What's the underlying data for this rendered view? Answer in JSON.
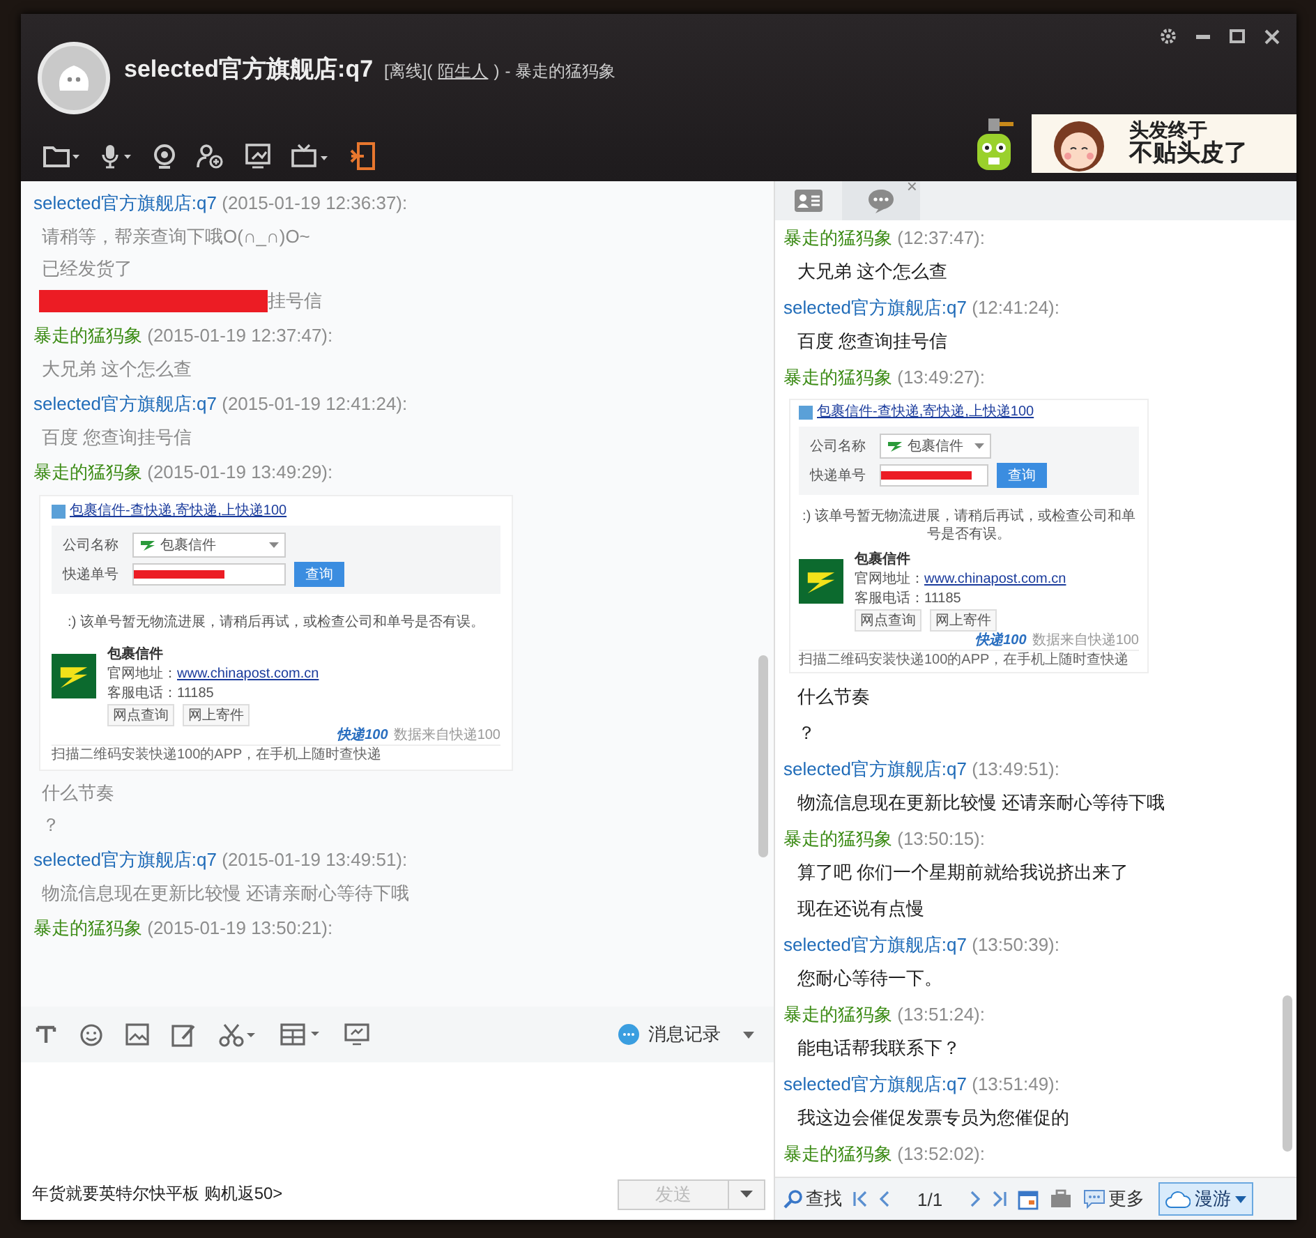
{
  "header": {
    "title": "selected官方旗舰店:q7",
    "status": "[离线](",
    "relation": "陌生人",
    "relation_suffix": ")",
    "nick": "- 暴走的猛犸象",
    "ad_lines": [
      "头发终于",
      "不贴头皮了"
    ]
  },
  "chat": {
    "messages": [
      {
        "sender": "selected官方旗舰店:q7",
        "kind": "shop",
        "time": "(2015-01-19 12:36:37):",
        "body": [
          {
            "kind": "text",
            "text": "请稍等，帮亲查询下哦O(∩_∩)O~"
          },
          {
            "kind": "text",
            "text": "已经发货了"
          },
          {
            "kind": "redacted",
            "text": "挂号信"
          }
        ]
      },
      {
        "sender": "暴走的猛犸象",
        "kind": "user",
        "time": "(2015-01-19 12:37:47):",
        "body": [
          {
            "kind": "text",
            "text": "大兄弟 这个怎么查"
          }
        ]
      },
      {
        "sender": "selected官方旗舰店:q7",
        "kind": "shop",
        "time": "(2015-01-19 12:41:24):",
        "body": [
          {
            "kind": "text",
            "text": "百度 您查询挂号信"
          }
        ]
      },
      {
        "sender": "暴走的猛犸象",
        "kind": "user",
        "time": "(2015-01-19 13:49:29):",
        "body": [
          {
            "kind": "card",
            "card": {
              "link": "包裹信件-查快递,寄快递,上快递100",
              "company_label": "公司名称",
              "company_value": "包裹信件",
              "number_label": "快递单号",
              "query_button": "查询",
              "notice": ":) 该单号暂无物流进展，请稍后再试，或检查公司和单号是否有误。",
              "carrier_name": "包裹信件",
              "site_label": "官网地址：",
              "site_url": "www.chinapost.com.cn",
              "phone": "客服电话：11185",
              "buttons": [
                "网点查询",
                "网上寄件"
              ],
              "brand": "快递100",
              "source": "数据来自快递100",
              "footer": "扫描二维码安装快递100的APP，在手机上随时查快递"
            }
          },
          {
            "kind": "text",
            "text": "什么节奏"
          },
          {
            "kind": "text",
            "text": "？"
          }
        ]
      },
      {
        "sender": "selected官方旗舰店:q7",
        "kind": "shop",
        "time": "(2015-01-19 13:49:51):",
        "body": [
          {
            "kind": "text",
            "text": "物流信息现在更新比较慢 还请亲耐心等待下哦"
          }
        ]
      },
      {
        "sender": "暴走的猛犸象",
        "kind": "user",
        "time": "(2015-01-19 13:50:21):"
      }
    ],
    "input_toolbar": {
      "history_label": "消息记录"
    },
    "ad_link": "年货就要英特尔快平板 购机返50>",
    "send_button": {
      "label": "发送",
      "disabled": true
    }
  },
  "side": {
    "tabs": [
      {
        "kind": "contact",
        "selected": false,
        "closable": false
      },
      {
        "kind": "chat",
        "selected": true,
        "closable": true
      }
    ],
    "close_mark": "×",
    "messages": [
      {
        "sender": "暴走的猛犸象",
        "kind": "user",
        "time": "(12:37:47):",
        "body": [
          {
            "kind": "text",
            "text": "大兄弟 这个怎么查"
          }
        ]
      },
      {
        "sender": "selected官方旗舰店:q7",
        "kind": "shop",
        "time": "(12:41:24):",
        "body": [
          {
            "kind": "text",
            "text": "百度 您查询挂号信"
          }
        ]
      },
      {
        "sender": "暴走的猛犸象",
        "kind": "user",
        "time": "(13:49:27):",
        "body": [
          {
            "kind": "card",
            "card": {
              "link": "包裹信件-查快递,寄快递,上快递100",
              "company_label": "公司名称",
              "company_value": "包裹信件",
              "number_label": "快递单号",
              "query_button": "查询",
              "notice": ":) 该单号暂无物流进展，请稍后再试，或检查公司和单号是否有误。",
              "carrier_name": "包裹信件",
              "site_label": "官网地址：",
              "site_url": "www.chinapost.com.cn",
              "phone": "客服电话：11185",
              "buttons": [
                "网点查询",
                "网上寄件"
              ],
              "brand": "快递100",
              "source": "数据来自快递100",
              "footer": "扫描二维码安装快递100的APP，在手机上随时查快递"
            }
          },
          {
            "kind": "text",
            "text": "什么节奏"
          },
          {
            "kind": "text",
            "text": "？"
          }
        ]
      },
      {
        "sender": "selected官方旗舰店:q7",
        "kind": "shop",
        "time": "(13:49:51):",
        "body": [
          {
            "kind": "text",
            "text": "物流信息现在更新比较慢 还请亲耐心等待下哦"
          }
        ]
      },
      {
        "sender": "暴走的猛犸象",
        "kind": "user",
        "time": "(13:50:15):",
        "body": [
          {
            "kind": "text",
            "text": "算了吧 你们一个星期前就给我说挤出来了"
          },
          {
            "kind": "text",
            "text": "现在还说有点慢"
          }
        ]
      },
      {
        "sender": "selected官方旗舰店:q7",
        "kind": "shop",
        "time": "(13:50:39):",
        "body": [
          {
            "kind": "text",
            "text": "您耐心等待一下。"
          }
        ]
      },
      {
        "sender": "暴走的猛犸象",
        "kind": "user",
        "time": "(13:51:24):",
        "body": [
          {
            "kind": "text",
            "text": "能电话帮我联系下？"
          }
        ]
      },
      {
        "sender": "selected官方旗舰店:q7",
        "kind": "shop",
        "time": "(13:51:49):",
        "body": [
          {
            "kind": "text",
            "text": "我这边会催促发票专员为您催促的"
          }
        ]
      },
      {
        "sender": "暴走的猛犸象",
        "kind": "user",
        "time": "(13:52:02):"
      }
    ],
    "footer": {
      "search_label": "查找",
      "page": "1/1",
      "more_label": "更多",
      "roam_label": "漫游"
    }
  }
}
